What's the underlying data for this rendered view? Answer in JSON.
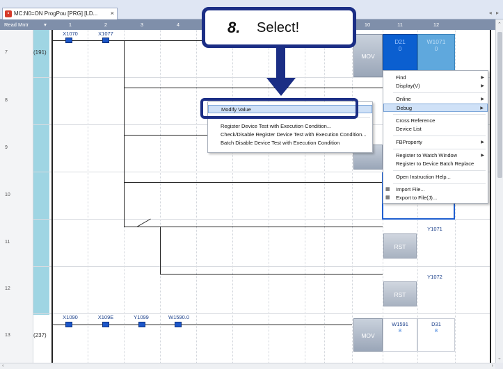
{
  "tab": {
    "title": "MC:N0=ON ProgPou [PRG] [LD...",
    "close": "×",
    "icon": "ladder-program-icon"
  },
  "tabbar_arrows": "◂ ▸",
  "columns": {
    "read_mode": "Read Mntr",
    "dropdown": "▾",
    "numbers": [
      "1",
      "2",
      "3",
      "4",
      "5",
      "6",
      "7",
      "8",
      "9",
      "10",
      "11",
      "12"
    ]
  },
  "rows": [
    {
      "num": "7",
      "step": "(191)"
    },
    {
      "num": "8",
      "step": ""
    },
    {
      "num": "9",
      "step": ""
    },
    {
      "num": "10",
      "step": ""
    },
    {
      "num": "11",
      "step": ""
    },
    {
      "num": "12",
      "step": ""
    },
    {
      "num": "13",
      "step": "(237)"
    }
  ],
  "contacts_row7": [
    "X1070",
    "X1077"
  ],
  "contacts_row13": [
    "X1090",
    "X109E",
    "Y1099",
    "W1590.0"
  ],
  "instructions": {
    "mov_row7": "MOV",
    "d21_label": "D21",
    "d21_value": "0",
    "w1071_label": "W1071",
    "w1071_value": "0",
    "rst_row11": "RST",
    "y1071": "Y1071",
    "rst_row12": "RST",
    "y1072": "Y1072",
    "mov_row13": "MOV",
    "w1591_label": "W1591",
    "w1591_value": "8",
    "d31_label": "D31",
    "d31_value": "8"
  },
  "context_menu": {
    "items": [
      {
        "label": "Find",
        "submenu": true
      },
      {
        "label": "Display(V)",
        "submenu": true
      },
      {
        "label": "Online",
        "submenu": true
      },
      {
        "label": "Debug",
        "submenu": true,
        "highlighted": true
      },
      {
        "label": "Cross Reference",
        "submenu": false
      },
      {
        "label": "Device List",
        "submenu": false
      },
      {
        "label": "FBProperty",
        "submenu": true
      },
      {
        "label": "Register to Watch Window",
        "submenu": true
      },
      {
        "label": "Register to Device Batch Replace",
        "submenu": false
      },
      {
        "label": "Open Instruction Help...",
        "submenu": false
      },
      {
        "label": "Import File...",
        "submenu": false,
        "icon": "import-file-icon"
      },
      {
        "label": "Export to File(J)...",
        "submenu": false,
        "icon": "export-file-icon"
      }
    ]
  },
  "debug_submenu": {
    "items": [
      {
        "label": "Modify Value",
        "highlighted": true
      },
      {
        "label": "Register Device Test with Execution Condition..."
      },
      {
        "label": "Check/Disable Register Device Test with Execution Condition..."
      },
      {
        "label": "Batch Disable Device Test with Execution Condition"
      }
    ]
  },
  "callout": {
    "step": "8.",
    "text": "Select!"
  },
  "submenu_arrow": "▶",
  "scroll": {
    "up": "⌃",
    "down": "⌄",
    "left": "‹",
    "right": "›"
  }
}
